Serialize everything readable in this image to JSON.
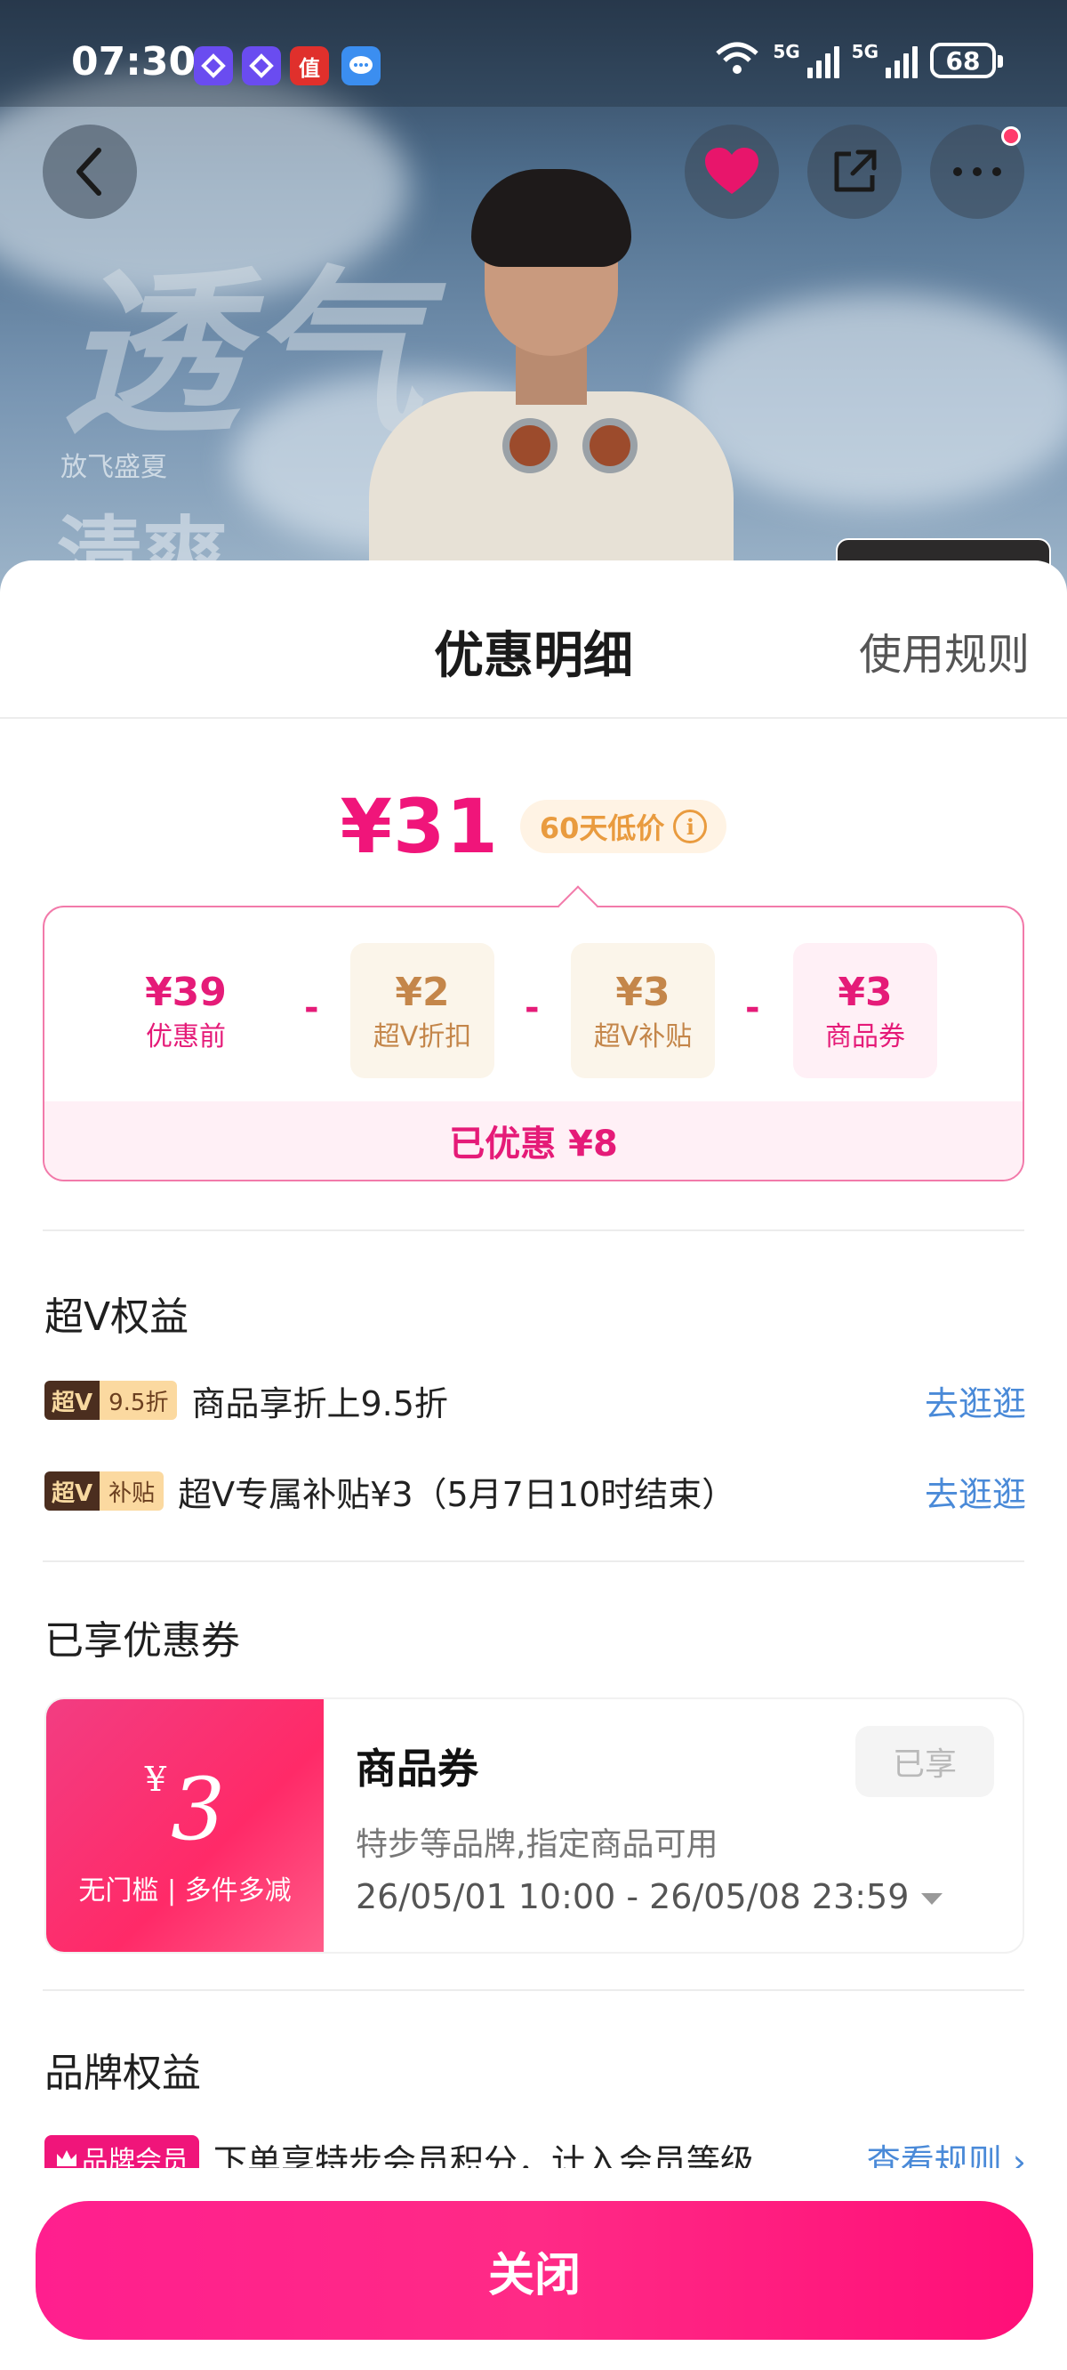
{
  "status_bar": {
    "time": "07:30",
    "net_label_1": "5G",
    "net_label_2": "5G",
    "battery": "68",
    "app_icons": [
      "blue-app-icon",
      "blue-app-icon-2",
      "zhi-app-icon",
      "message-app-icon"
    ],
    "zhi_glyph": "值"
  },
  "hero": {
    "big_word": "透气",
    "sub_text": "放飞盛夏",
    "word2": "清爽"
  },
  "sheet": {
    "title": "优惠明细",
    "rules_link": "使用规则",
    "final_price": "¥31",
    "low_price_badge": "60天低价",
    "calc": {
      "items": [
        {
          "value": "¥39",
          "label": "优惠前"
        },
        {
          "value": "¥2",
          "label": "超V折扣"
        },
        {
          "value": "¥3",
          "label": "超V补贴"
        },
        {
          "value": "¥3",
          "label": "商品券"
        }
      ],
      "operator": "-",
      "saved_text": "已优惠 ¥8"
    },
    "super_v": {
      "title": "超V权益",
      "perks": [
        {
          "tag_dark": "超V",
          "tag_light": "9.5折",
          "text": "商品享折上9.5折",
          "link": "去逛逛"
        },
        {
          "tag_dark": "超V",
          "tag_light": "补贴",
          "text": "超V专属补贴¥3（5月7日10时结束）",
          "link": "去逛逛"
        }
      ]
    },
    "coupons": {
      "title": "已享优惠券",
      "item": {
        "symbol": "¥",
        "amount": "3",
        "condition": "无门槛 | 多件多减",
        "name": "商品券",
        "desc": "特步等品牌,指定商品可用",
        "date": "26/05/01 10:00 - 26/05/08 23:59",
        "status": "已享"
      }
    },
    "brand": {
      "title": "品牌权益",
      "tag": "品牌会员",
      "text": "下单享特步会员积分，计入会员等级",
      "link": "查看规则 ›"
    }
  },
  "footer": {
    "close_label": "关闭"
  },
  "colors": {
    "accent": "#f0157a",
    "gold": "#c4864a",
    "link": "#4a8ad8"
  }
}
